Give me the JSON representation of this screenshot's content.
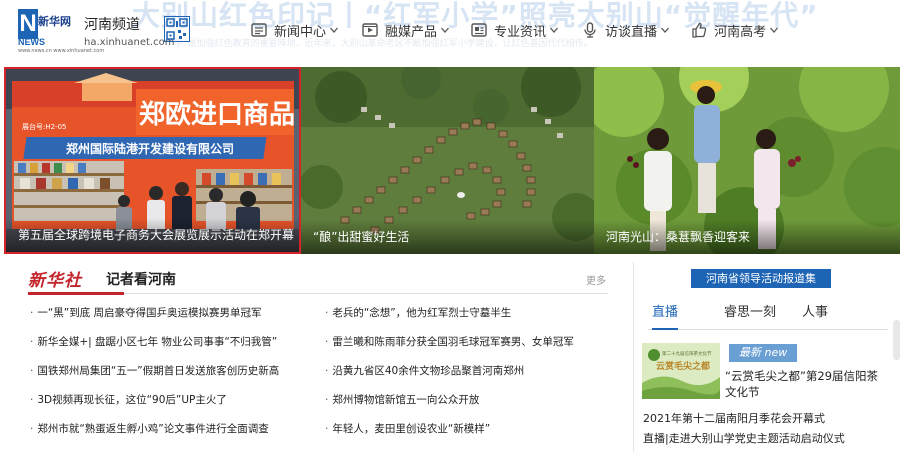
{
  "header": {
    "banner_text": "大别山红色印记丨“红军小学”照亮大别山“觉醒年代”",
    "banner_subtext": "小学”是加强红色教育的重要阵地，近年来，大别山革命老区不断加强红军小学建设，让红色基因代代相传。",
    "logo": {
      "cn": "新华网",
      "news": "NEWS",
      "url": "www.news.cn  www.xinhuanet.com"
    },
    "channel_title": "河南频道",
    "channel_url": "ha.xinhuanet.com",
    "qr_icon": "qr-code-icon",
    "nav": [
      {
        "label": "新闻中心",
        "icon": "news-center-icon"
      },
      {
        "label": "融媒产品",
        "icon": "media-product-icon"
      },
      {
        "label": "专业资讯",
        "icon": "info-icon"
      },
      {
        "label": "访谈直播",
        "icon": "microphone-icon"
      },
      {
        "label": "河南高考",
        "icon": "thumb-up-icon"
      }
    ]
  },
  "hero": [
    {
      "caption": "第五届全球跨境电子商务大会展览展示活动在郑开幕",
      "booth_sign": "郑欧进口商品",
      "booth_sub": "郑州国际陆港开发建设有限公司",
      "booth_no": "展台号:H2-05",
      "selected": true
    },
    {
      "caption": "“酿”出甜蜜好生活"
    },
    {
      "caption": "河南光山：桑葚飘香迎客来"
    }
  ],
  "reporters": {
    "logo_text": "新华社",
    "title": "记者看河南",
    "more": "更多",
    "left": [
      "一“黑”到底 周启豪夺得国乒奥运模拟赛男单冠军",
      "新华全媒+| 盘踞小区七年 物业公司事事“不归我管”",
      "国铁郑州局集团“五一”假期首日发送旅客创历史新高",
      "3D视频再现长征，这位“90后”UP主火了",
      "郑州市就“熟蛋返生孵小鸡”论文事件进行全面调查"
    ],
    "right": [
      "老兵的“念想”，他为红军烈士守墓半生",
      "雷兰曦和陈雨菲分获全国羽毛球冠军赛男、女单冠军",
      "沿黄九省区40余件文物珍品聚首河南郑州",
      "郑州博物馆新馆五一向公众开放",
      "年轻人，麦田里创设农业“新模样”"
    ]
  },
  "side": {
    "leaders_button": "河南省领导活动报道集",
    "tabs": [
      {
        "label": "直播",
        "active": true
      },
      {
        "label": "睿思一刻",
        "active": false
      },
      {
        "label": "人事",
        "active": false
      }
    ],
    "feature": {
      "badge": "最新 new",
      "title": "“云赏毛尖之都”第29届信阳茶文化节",
      "thumb_text": "第二十九届信阳茶文化节 云赏毛尖之都"
    },
    "list": [
      "2021年第十二届南阳月季花会开幕式",
      "直播|走进大别山学党史主题活动启动仪式"
    ]
  },
  "colors": {
    "brand_blue": "#1d64b5",
    "accent_red": "#c3252c",
    "highlight_red": "#d6232b",
    "badge_blue": "#6a9fd4"
  }
}
